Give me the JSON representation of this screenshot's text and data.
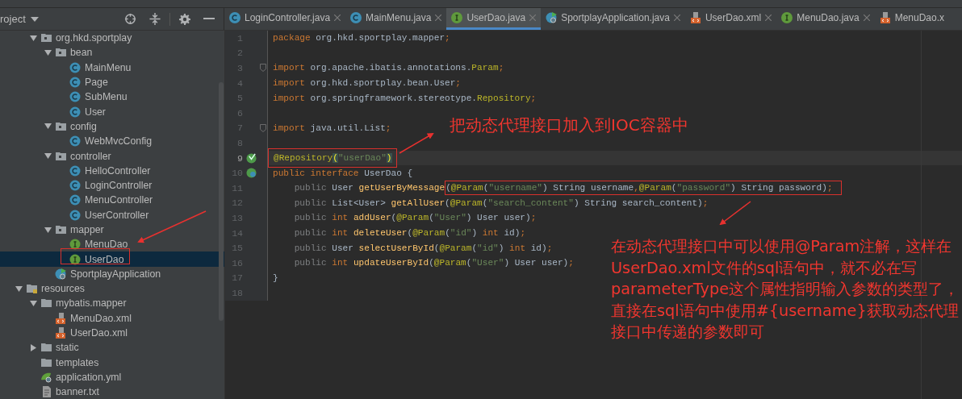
{
  "project_panel": {
    "title": "roject"
  },
  "tabs": [
    {
      "label": "LoginController.java",
      "kind": "class",
      "selected": false,
      "closable": true
    },
    {
      "label": "MainMenu.java",
      "kind": "class",
      "selected": false,
      "closable": true
    },
    {
      "label": "UserDao.java",
      "kind": "interface",
      "selected": true,
      "closable": true
    },
    {
      "label": "SportplayApplication.java",
      "kind": "spring",
      "selected": false,
      "closable": true
    },
    {
      "label": "UserDao.xml",
      "kind": "xml",
      "selected": false,
      "closable": true
    },
    {
      "label": "MenuDao.java",
      "kind": "interface",
      "selected": false,
      "closable": true
    },
    {
      "label": "MenuDao.x",
      "kind": "xml",
      "selected": false,
      "closable": false
    }
  ],
  "tree": [
    {
      "label": "org.hkd.sportplay",
      "kind": "package",
      "expanded": true,
      "selected": false,
      "children": [
        {
          "label": "bean",
          "kind": "package",
          "expanded": true,
          "selected": false,
          "children": [
            {
              "label": "MainMenu",
              "kind": "class",
              "selected": false
            },
            {
              "label": "Page",
              "kind": "class",
              "selected": false
            },
            {
              "label": "SubMenu",
              "kind": "class",
              "selected": false
            },
            {
              "label": "User",
              "kind": "class",
              "selected": false
            }
          ]
        },
        {
          "label": "config",
          "kind": "package",
          "expanded": true,
          "selected": false,
          "children": [
            {
              "label": "WebMvcConfig",
              "kind": "class",
              "selected": false
            }
          ]
        },
        {
          "label": "controller",
          "kind": "package",
          "expanded": true,
          "selected": false,
          "children": [
            {
              "label": "HelloController",
              "kind": "class",
              "selected": false
            },
            {
              "label": "LoginController",
              "kind": "class",
              "selected": false
            },
            {
              "label": "MenuController",
              "kind": "class",
              "selected": false
            },
            {
              "label": "UserController",
              "kind": "class",
              "selected": false
            }
          ]
        },
        {
          "label": "mapper",
          "kind": "package",
          "expanded": true,
          "selected": false,
          "children": [
            {
              "label": "MenuDao",
              "kind": "interface",
              "selected": false
            },
            {
              "label": "UserDao",
              "kind": "interface",
              "selected": true
            }
          ]
        },
        {
          "label": "SportplayApplication",
          "kind": "spring",
          "selected": false
        }
      ]
    },
    {
      "label": "resources",
      "kind": "resources",
      "expanded": true,
      "selected": false,
      "children": [
        {
          "label": "mybatis.mapper",
          "kind": "folder",
          "expanded": true,
          "selected": false,
          "children": [
            {
              "label": "MenuDao.xml",
              "kind": "xml",
              "selected": false
            },
            {
              "label": "UserDao.xml",
              "kind": "xml",
              "selected": false
            }
          ]
        },
        {
          "label": "static",
          "kind": "folder",
          "expanded": false,
          "selected": false
        },
        {
          "label": "templates",
          "kind": "folder",
          "selected": false
        },
        {
          "label": "application.yml",
          "kind": "yml",
          "selected": false
        },
        {
          "label": "banner.txt",
          "kind": "txt",
          "selected": false
        }
      ]
    }
  ],
  "code_lines": [
    {
      "number": "1",
      "tokens": [
        {
          "kind": "keyword",
          "text": "package"
        },
        {
          "kind": "plain",
          "text": " org.hkd.sportplay.mapper"
        },
        {
          "kind": "keyword",
          "text": ";"
        }
      ]
    },
    {
      "number": "2"
    },
    {
      "number": "3",
      "fold": true,
      "tokens": [
        {
          "kind": "keyword",
          "text": "import"
        },
        {
          "kind": "plain",
          "text": " org.apache.ibatis.annotations."
        },
        {
          "kind": "annotation",
          "text": "Param"
        },
        {
          "kind": "keyword",
          "text": ";"
        }
      ]
    },
    {
      "number": "4",
      "tokens": [
        {
          "kind": "keyword",
          "text": "import"
        },
        {
          "kind": "plain",
          "text": " org.hkd.sportplay.bean.User"
        },
        {
          "kind": "keyword",
          "text": ";"
        }
      ]
    },
    {
      "number": "5",
      "tokens": [
        {
          "kind": "keyword",
          "text": "import"
        },
        {
          "kind": "plain",
          "text": " org.springframework.stereotype."
        },
        {
          "kind": "annotation",
          "text": "Repository"
        },
        {
          "kind": "keyword",
          "text": ";"
        }
      ]
    },
    {
      "number": "6"
    },
    {
      "number": "7",
      "fold": true,
      "tokens": [
        {
          "kind": "keyword",
          "text": "import"
        },
        {
          "kind": "plain",
          "text": " java.util.List"
        },
        {
          "kind": "keyword",
          "text": ";"
        }
      ]
    },
    {
      "number": "8"
    },
    {
      "number": "9",
      "kind": "bean",
      "current": true,
      "boxed": true,
      "tokens": [
        {
          "kind": "annotation",
          "text": "@Repository"
        },
        {
          "kind": "brace",
          "text": "("
        },
        {
          "kind": "string",
          "text": "\"userDao\""
        },
        {
          "kind": "brace",
          "text": ")"
        }
      ]
    },
    {
      "number": "10",
      "kind": "implemented",
      "tokens": [
        {
          "kind": "keyword",
          "text": "public interface "
        },
        {
          "kind": "plain",
          "text": "UserDao {"
        }
      ],
      "children": [
        {
          "number": "11",
          "tokens": [
            {
              "kind": "modifier",
              "text": "public"
            },
            {
              "kind": "plain",
              "text": " User "
            },
            {
              "kind": "method",
              "text": "getUserByMessage"
            },
            {
              "kind": "boxed",
              "tokens": [
                {
                  "kind": "plain",
                  "text": "("
                },
                {
                  "kind": "annotation",
                  "text": "@Param"
                },
                {
                  "kind": "plain",
                  "text": "("
                },
                {
                  "kind": "string",
                  "text": "\"username\""
                },
                {
                  "kind": "plain",
                  "text": ") String username"
                },
                {
                  "kind": "keyword",
                  "text": ","
                },
                {
                  "kind": "annotation",
                  "text": "@Param"
                },
                {
                  "kind": "plain",
                  "text": "("
                },
                {
                  "kind": "string",
                  "text": "\"password\""
                },
                {
                  "kind": "plain",
                  "text": ") String password)"
                },
                {
                  "kind": "keyword",
                  "text": ";"
                }
              ]
            }
          ]
        },
        {
          "number": "12",
          "tokens": [
            {
              "kind": "modifier",
              "text": "public"
            },
            {
              "kind": "plain",
              "text": " List<User> "
            },
            {
              "kind": "method",
              "text": "getAllUser"
            },
            {
              "kind": "plain",
              "text": "("
            },
            {
              "kind": "annotation",
              "text": "@Param"
            },
            {
              "kind": "plain",
              "text": "("
            },
            {
              "kind": "string",
              "text": "\"search_content\""
            },
            {
              "kind": "plain",
              "text": ") String search_content)"
            },
            {
              "kind": "keyword",
              "text": ";"
            }
          ]
        },
        {
          "number": "13",
          "tokens": [
            {
              "kind": "modifier",
              "text": "public"
            },
            {
              "kind": "keyword",
              "text": " int "
            },
            {
              "kind": "method",
              "text": "addUser"
            },
            {
              "kind": "plain",
              "text": "("
            },
            {
              "kind": "annotation",
              "text": "@Param"
            },
            {
              "kind": "plain",
              "text": "("
            },
            {
              "kind": "string",
              "text": "\"User\""
            },
            {
              "kind": "plain",
              "text": ") User user)"
            },
            {
              "kind": "keyword",
              "text": ";"
            }
          ]
        },
        {
          "number": "14",
          "tokens": [
            {
              "kind": "modifier",
              "text": "public"
            },
            {
              "kind": "keyword",
              "text": " int "
            },
            {
              "kind": "method",
              "text": "deleteUser"
            },
            {
              "kind": "plain",
              "text": "("
            },
            {
              "kind": "annotation",
              "text": "@Param"
            },
            {
              "kind": "plain",
              "text": "("
            },
            {
              "kind": "string",
              "text": "\"id\""
            },
            {
              "kind": "plain",
              "text": ") "
            },
            {
              "kind": "keyword",
              "text": "int"
            },
            {
              "kind": "plain",
              "text": " id)"
            },
            {
              "kind": "keyword",
              "text": ";"
            }
          ]
        },
        {
          "number": "15",
          "tokens": [
            {
              "kind": "modifier",
              "text": "public"
            },
            {
              "kind": "plain",
              "text": " User "
            },
            {
              "kind": "method",
              "text": "selectUserById"
            },
            {
              "kind": "plain",
              "text": "("
            },
            {
              "kind": "annotation",
              "text": "@Param"
            },
            {
              "kind": "plain",
              "text": "("
            },
            {
              "kind": "string",
              "text": "\"id\""
            },
            {
              "kind": "plain",
              "text": ") "
            },
            {
              "kind": "keyword",
              "text": "int"
            },
            {
              "kind": "plain",
              "text": " id)"
            },
            {
              "kind": "keyword",
              "text": ";"
            }
          ]
        },
        {
          "number": "16",
          "tokens": [
            {
              "kind": "modifier",
              "text": "public"
            },
            {
              "kind": "keyword",
              "text": " int "
            },
            {
              "kind": "method",
              "text": "updateUserById"
            },
            {
              "kind": "plain",
              "text": "("
            },
            {
              "kind": "annotation",
              "text": "@Param"
            },
            {
              "kind": "plain",
              "text": "("
            },
            {
              "kind": "string",
              "text": "\"User\""
            },
            {
              "kind": "plain",
              "text": ") User user)"
            },
            {
              "kind": "keyword",
              "text": ";"
            }
          ]
        }
      ]
    },
    {
      "number": "17",
      "tokens": [
        {
          "kind": "plain",
          "text": "}"
        }
      ]
    },
    {
      "number": "18"
    }
  ],
  "annotations": [
    {
      "text": "把动态代理接口加入到IOC容器中"
    },
    {
      "text": "在动态代理接口中可以使用@Param注解，这样在UserDao.xml文件的sql语句中，就不必在写parameterType这个属性指明输入参数的类型了，直接在sql语句中使用#{username}获取动态代理接口中传递的参数即可"
    }
  ]
}
